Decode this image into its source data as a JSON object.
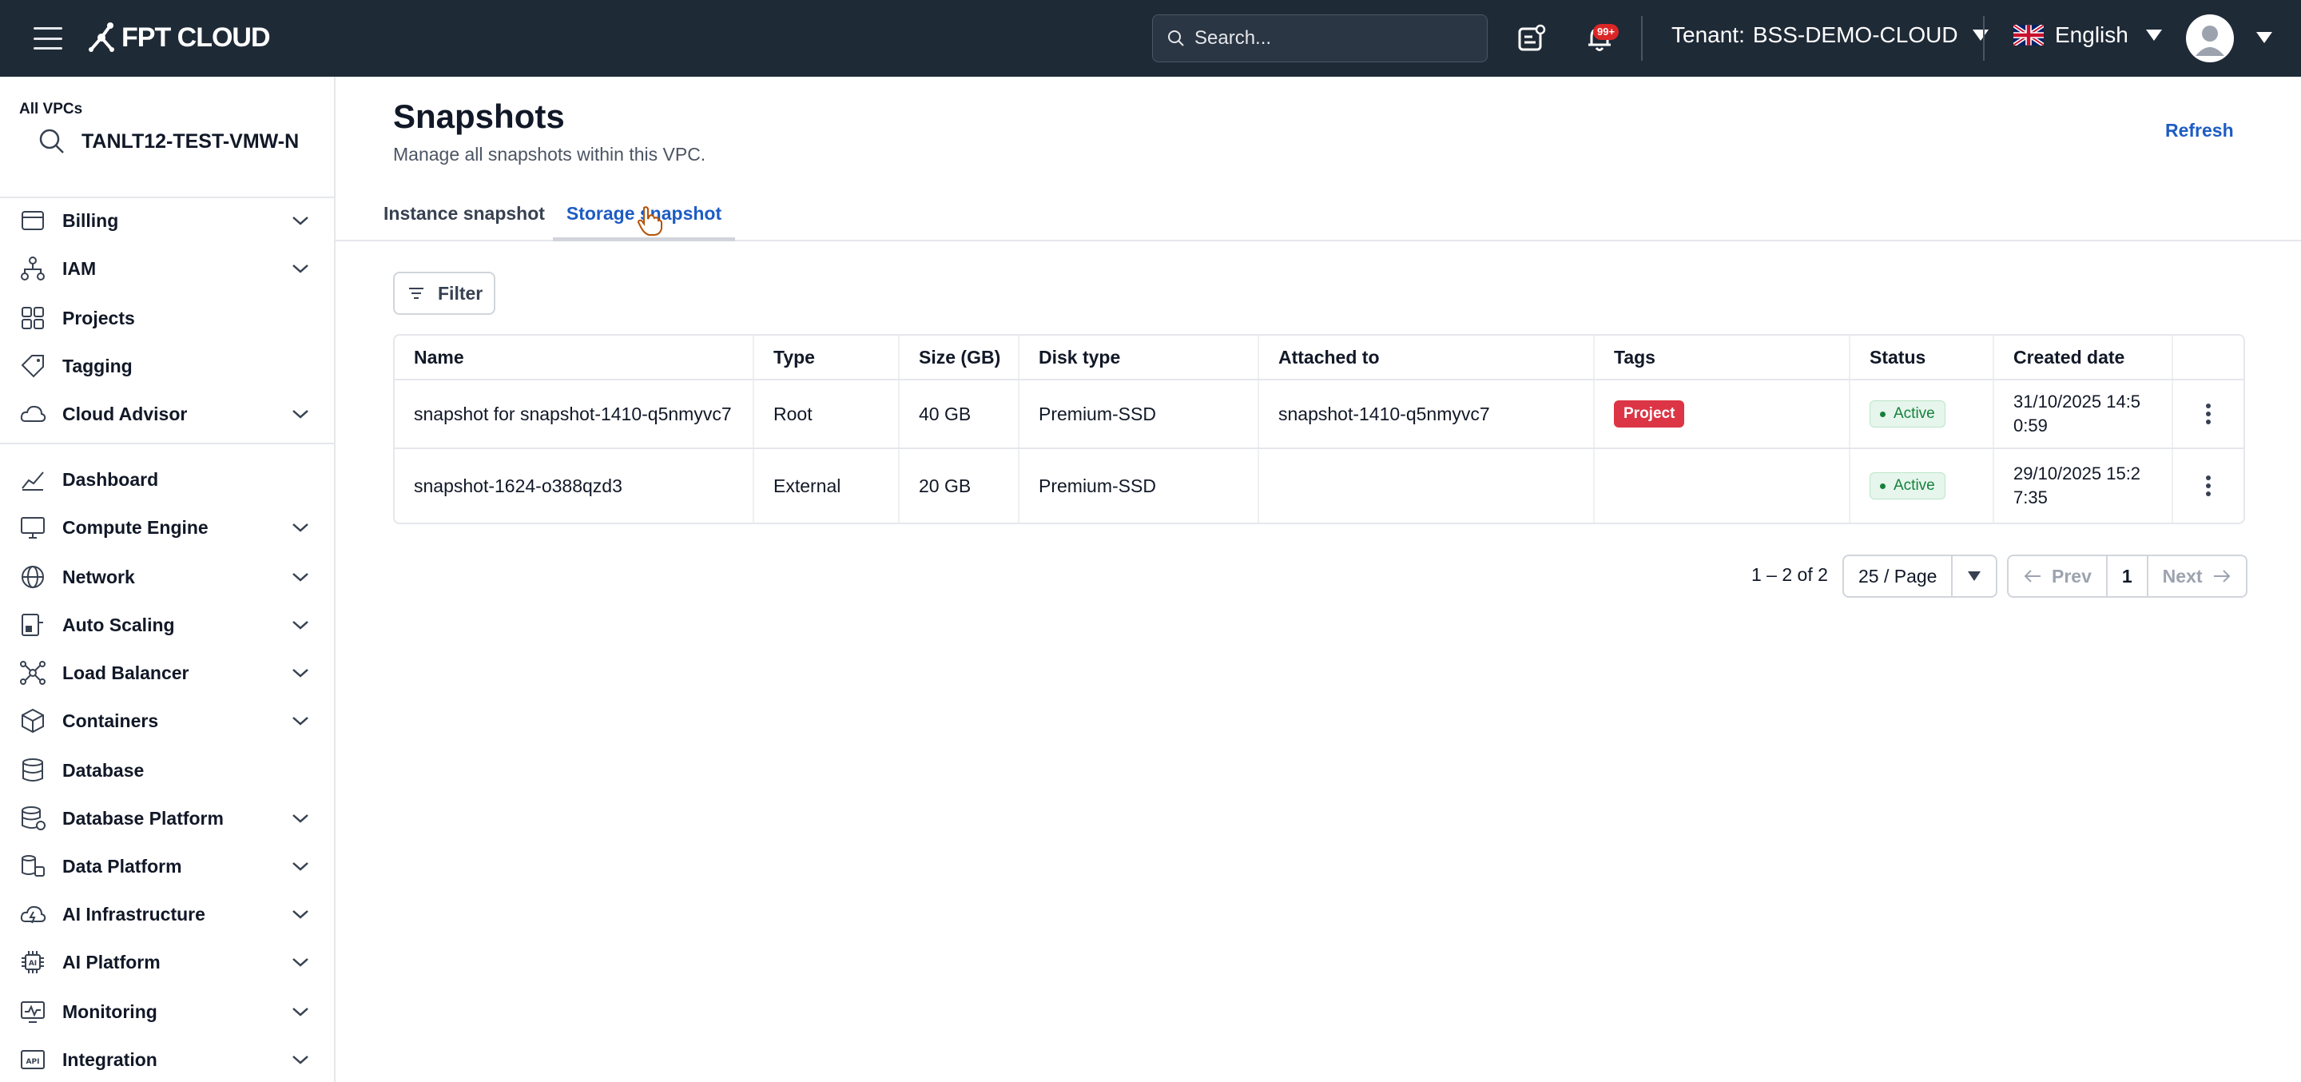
{
  "header": {
    "brand": "FPT CLOUD",
    "search_placeholder": "Search...",
    "notification_count": "99+",
    "tenant_label": "Tenant:",
    "tenant_value": "BSS-DEMO-CLOUD",
    "language": "English"
  },
  "sidebar": {
    "vpc_label": "All VPCs",
    "vpc_name": "TANLT12-TEST-VMW-N",
    "items": [
      {
        "label": "Billing",
        "icon": "billing-icon",
        "expandable": true
      },
      {
        "label": "IAM",
        "icon": "iam-icon",
        "expandable": true
      },
      {
        "label": "Projects",
        "icon": "projects-icon",
        "expandable": false
      },
      {
        "label": "Tagging",
        "icon": "tag-icon",
        "expandable": false
      },
      {
        "label": "Cloud Advisor",
        "icon": "cloud-icon",
        "expandable": true
      },
      {
        "label": "Dashboard",
        "icon": "chart-icon",
        "expandable": false
      },
      {
        "label": "Compute Engine",
        "icon": "monitor-icon",
        "expandable": true
      },
      {
        "label": "Network",
        "icon": "globe-icon",
        "expandable": true
      },
      {
        "label": "Auto Scaling",
        "icon": "scaling-icon",
        "expandable": true
      },
      {
        "label": "Load Balancer",
        "icon": "load-balancer-icon",
        "expandable": true
      },
      {
        "label": "Containers",
        "icon": "box-icon",
        "expandable": true
      },
      {
        "label": "Database",
        "icon": "database-icon",
        "expandable": false
      },
      {
        "label": "Database Platform",
        "icon": "database-platform-icon",
        "expandable": true
      },
      {
        "label": "Data Platform",
        "icon": "data-platform-icon",
        "expandable": true
      },
      {
        "label": "AI Infrastructure",
        "icon": "ai-infra-icon",
        "expandable": true
      },
      {
        "label": "AI Platform",
        "icon": "ai-chip-icon",
        "expandable": true
      },
      {
        "label": "Monitoring",
        "icon": "monitoring-icon",
        "expandable": true
      },
      {
        "label": "Integration",
        "icon": "api-icon",
        "expandable": true
      }
    ]
  },
  "main": {
    "title": "Snapshots",
    "subtitle": "Manage all snapshots within this VPC.",
    "refresh_label": "Refresh",
    "tabs": [
      {
        "label": "Instance snapshot",
        "active": false
      },
      {
        "label": "Storage snapshot",
        "active": true
      }
    ],
    "filter_label": "Filter",
    "table": {
      "columns": [
        "Name",
        "Type",
        "Size (GB)",
        "Disk type",
        "Attached to",
        "Tags",
        "Status",
        "Created date"
      ],
      "rows": [
        {
          "name": "snapshot for snapshot-1410-q5nmyvc7",
          "type": "Root",
          "size": "40 GB",
          "disk_type": "Premium-SSD",
          "attached_to": "snapshot-1410-q5nmyvc7",
          "tag": "Project",
          "status": "Active",
          "created_line1": "31/10/2025 14:5",
          "created_line2": "0:59"
        },
        {
          "name": "snapshot-1624-o388qzd3",
          "type": "External",
          "size": "20 GB",
          "disk_type": "Premium-SSD",
          "attached_to": "",
          "tag": "",
          "status": "Active",
          "created_line1": "29/10/2025 15:2",
          "created_line2": "7:35"
        }
      ]
    },
    "pagination": {
      "range": "1 – 2 of 2",
      "per_page": "25 / Page",
      "prev": "Prev",
      "page": "1",
      "next": "Next"
    }
  },
  "colors": {
    "topbar": "#1f2a37",
    "accent": "#1d5cc4",
    "tag": "#dc3545",
    "status_active": "#15803d"
  }
}
